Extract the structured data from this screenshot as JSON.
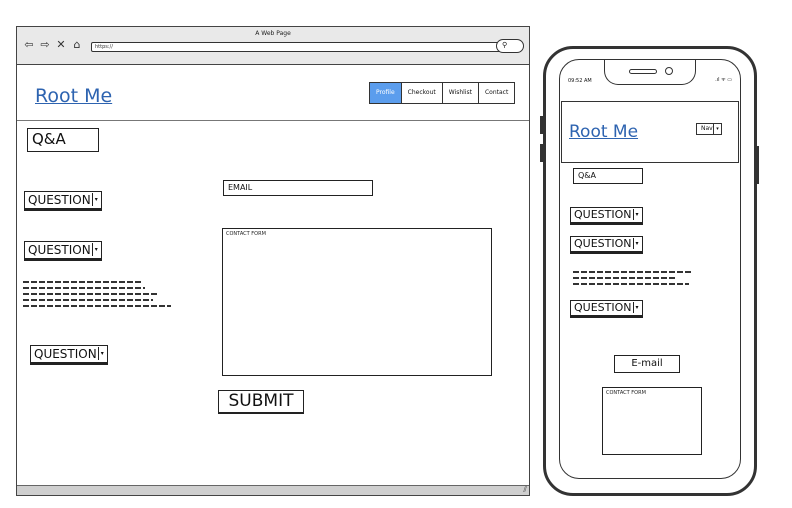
{
  "browser": {
    "title": "A Web Page",
    "url": "https://"
  },
  "desktop": {
    "logo": "Root Me",
    "nav": [
      "Profile",
      "Checkout",
      "Wishlist",
      "Contact"
    ],
    "active_nav": "Profile",
    "qa_label": "Q&A",
    "questions": [
      "QUESTION",
      "QUESTION",
      "QUESTION"
    ],
    "email_label": "EMAIL",
    "contact_form_label": "CONTACT FORM",
    "submit_label": "SUBMIT"
  },
  "mobile": {
    "status_time": "09:52 AM",
    "status_icons": ".ıl ᯤ ▭",
    "logo": "Root Me",
    "nav_select": "Nav",
    "qa_label": "Q&A",
    "questions": [
      "QUESTION",
      "QUESTION",
      "QUESTION"
    ],
    "email_label": "E-mail",
    "contact_form_label": "CONTACT FORM"
  },
  "colors": {
    "logo": "#2d63b0",
    "active_nav": "#5b9ded"
  }
}
